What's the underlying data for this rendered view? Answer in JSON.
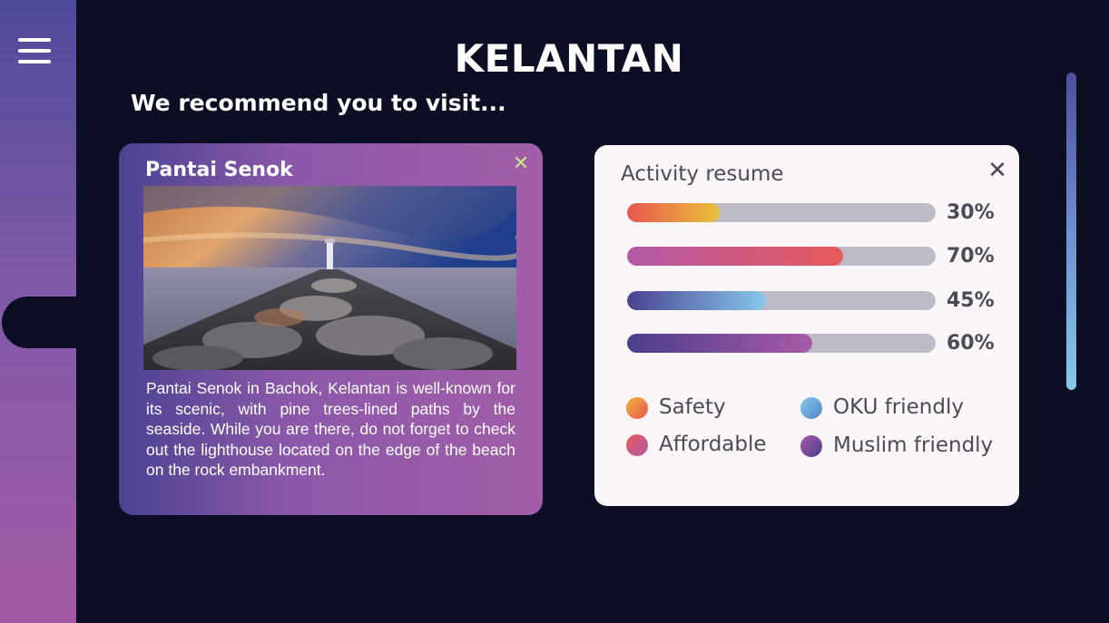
{
  "page": {
    "title": "KELANTAN",
    "subtitle": "We recommend you to visit..."
  },
  "sidebar": {
    "menu_icon": "hamburger-menu-icon"
  },
  "place": {
    "name": "Pantai Senok",
    "close_label": "✕",
    "image_icon": "beach-lighthouse-photo",
    "description": "Pantai Senok in Bachok, Kelantan is well-known for its scenic, with pine trees-lined paths by the seaside. While you are there, do not forget to check out the lighthouse located on the edge of the beach on the rock embankment."
  },
  "activity": {
    "title": "Activity resume",
    "close_label": "✕",
    "bars": [
      {
        "label": "30%",
        "value": 0.3,
        "colors": [
          "#e8564f",
          "#e9c23b"
        ]
      },
      {
        "label": "70%",
        "value": 0.7,
        "colors": [
          "#b25aa8",
          "#e85a5a"
        ]
      },
      {
        "label": "45%",
        "value": 0.45,
        "colors": [
          "#4a4392",
          "#86c8ea"
        ]
      },
      {
        "label": "60%",
        "value": 0.6,
        "colors": [
          "#4a3e8c",
          "#a85aa6"
        ]
      }
    ],
    "legend": [
      {
        "label": "Safety",
        "colors": [
          "#e8564f",
          "#f0b43c"
        ]
      },
      {
        "label": "OKU friendly",
        "colors": [
          "#4f86c6",
          "#86c8ea"
        ]
      },
      {
        "label": "Affordable",
        "colors": [
          "#b25aa8",
          "#e85a5a"
        ]
      },
      {
        "label": "Muslim friendly",
        "colors": [
          "#4a3e8c",
          "#a85aa6"
        ]
      }
    ]
  }
}
